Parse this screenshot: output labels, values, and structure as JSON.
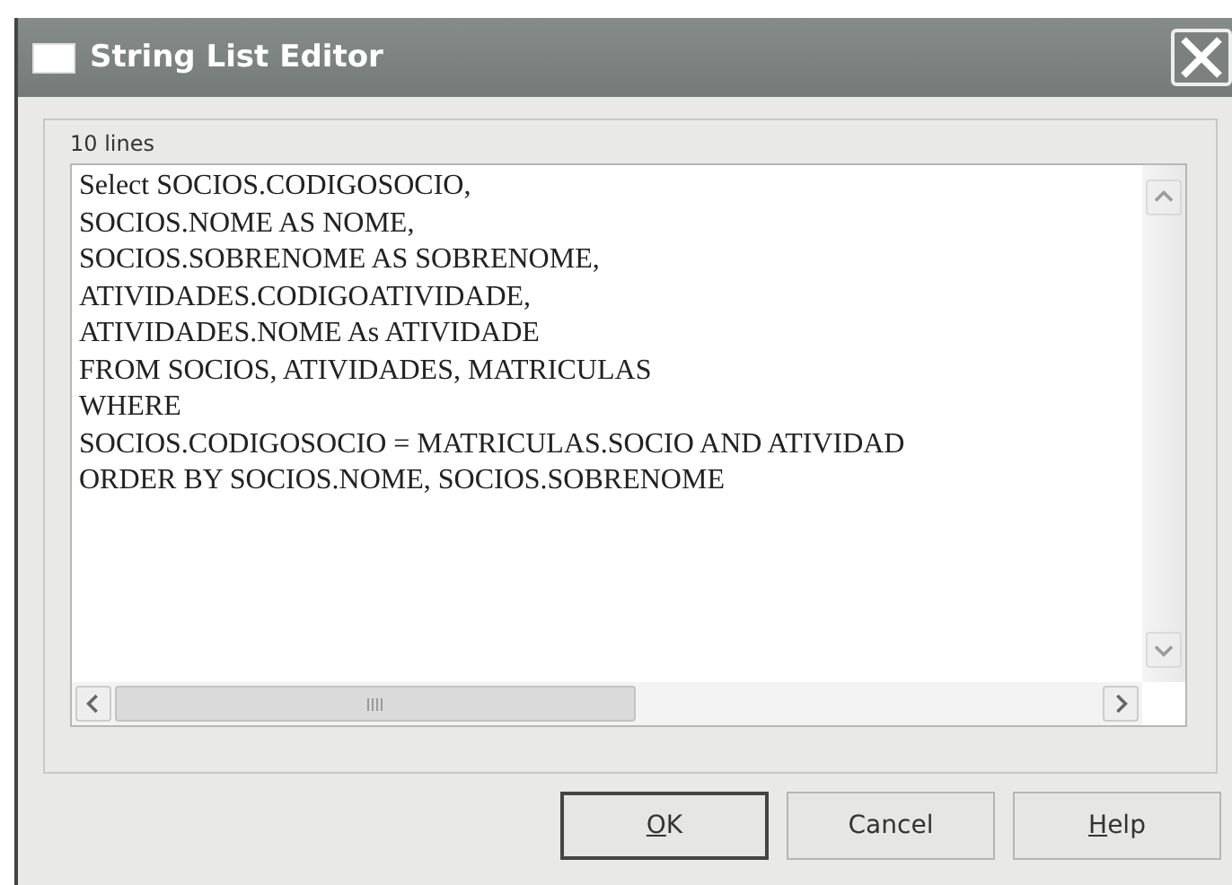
{
  "window": {
    "title": "String List Editor"
  },
  "editor": {
    "line_count": "10 lines",
    "lines": [
      "Select SOCIOS.CODIGOSOCIO,",
      "SOCIOS.NOME AS NOME,",
      "SOCIOS.SOBRENOME AS SOBRENOME,",
      "ATIVIDADES.CODIGOATIVIDADE,",
      "ATIVIDADES.NOME As ATIVIDADE",
      "FROM SOCIOS, ATIVIDADES, MATRICULAS",
      "WHERE",
      "SOCIOS.CODIGOSOCIO = MATRICULAS.SOCIO AND ATIVIDAD",
      "ORDER BY SOCIOS.NOME, SOCIOS.SOBRENOME"
    ]
  },
  "buttons": [
    {
      "label": "OK",
      "mnemonic": true,
      "default": true
    },
    {
      "label": "Cancel",
      "mnemonic": false,
      "default": false
    },
    {
      "label": "Help",
      "mnemonic": true,
      "default": false
    }
  ]
}
